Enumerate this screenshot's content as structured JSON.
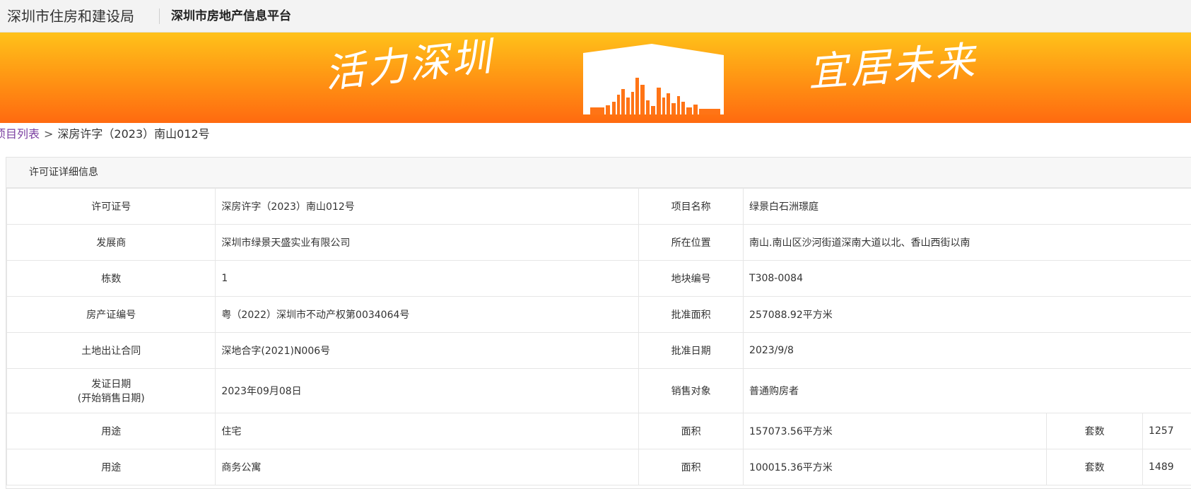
{
  "header": {
    "org_name": "深圳市住房和建设局",
    "platform_name": "深圳市房地产信息平台"
  },
  "banner": {
    "slogan_left": "活力深圳",
    "slogan_right": "宜居未来"
  },
  "breadcrumb": {
    "link_label": "项目列表",
    "separator": ">",
    "current": "深房许字（2023）南山012号"
  },
  "panel": {
    "title": "许可证详细信息"
  },
  "details": [
    {
      "label1": "许可证号",
      "value1": "深房许字（2023）南山012号",
      "label2": "项目名称",
      "value2": "绿景白石洲璟庭"
    },
    {
      "label1": "发展商",
      "value1": "深圳市绿景天盛实业有限公司",
      "label2": "所在位置",
      "value2": "南山.南山区沙河街道深南大道以北、香山西街以南"
    },
    {
      "label1": "栋数",
      "value1": "1",
      "label2": "地块编号",
      "value2": "T308-0084"
    },
    {
      "label1": "房产证编号",
      "value1": "粤（2022）深圳市不动产权第0034064号",
      "label2": "批准面积",
      "value2": "257088.92平方米"
    },
    {
      "label1": "土地出让合同",
      "value1": "深地合字(2021)N006号",
      "label2": "批准日期",
      "value2": "2023/9/8"
    },
    {
      "label1_line1": "发证日期",
      "label1_line2": "(开始销售日期)",
      "value1": "2023年09月08日",
      "label2": "销售对象",
      "value2": "普通购房者"
    }
  ],
  "usage_rows": [
    {
      "use_label": "用途",
      "use_value": "住宅",
      "area_label": "面积",
      "area_value": "157073.56平方米",
      "units_label": "套数",
      "units_value": "1257"
    },
    {
      "use_label": "用途",
      "use_value": "商务公寓",
      "area_label": "面积",
      "area_value": "100015.36平方米",
      "units_label": "套数",
      "units_value": "1489"
    }
  ]
}
